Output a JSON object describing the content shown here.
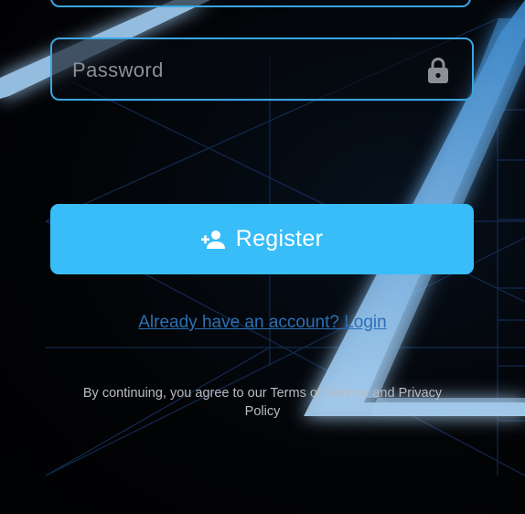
{
  "form": {
    "password_placeholder": "Password",
    "password_icon": "lock-icon"
  },
  "register_button": {
    "label": "Register",
    "icon": "person-add-icon"
  },
  "login_link": {
    "text": "Already have an account? Login"
  },
  "terms": {
    "text": "By continuing, you agree to our Terms of Service and Privacy Policy"
  },
  "colors": {
    "accent": "#38bdf8",
    "input_border": "#3aa6e0",
    "link": "#2c6fb5",
    "background": "#020305",
    "muted_text": "#b9bcc2"
  }
}
